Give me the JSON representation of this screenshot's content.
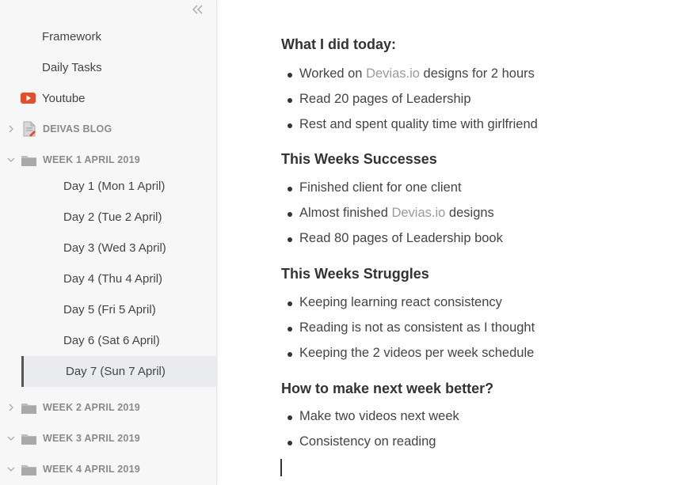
{
  "sidebar": {
    "items": [
      {
        "label": "Framework"
      },
      {
        "label": "Daily Tasks"
      },
      {
        "label": "Youtube"
      }
    ],
    "folders": [
      {
        "label": "DEIVAS BLOG"
      },
      {
        "label": "WEEK 1 APRIL 2019"
      },
      {
        "label": "WEEK 2 APRIL 2019"
      },
      {
        "label": "WEEK 3 APRIL 2019"
      },
      {
        "label": "WEEK 4 APRIL 2019"
      }
    ],
    "week1_days": [
      {
        "label": "Day 1 (Mon 1 April)"
      },
      {
        "label": "Day 2 (Tue 2 April)"
      },
      {
        "label": "Day 3 (Wed 3 April)"
      },
      {
        "label": "Day 4 (Thu 4 April)"
      },
      {
        "label": "Day 5 (Fri 5 April)"
      },
      {
        "label": "Day 6 (Sat 6 April)"
      },
      {
        "label": "Day 7 (Sun 7 April)"
      }
    ]
  },
  "doc": {
    "sections": [
      {
        "heading": "What I did today:",
        "items": [
          {
            "pre": "Worked on ",
            "link": "Devias.io",
            "post": " designs for 2 hours"
          },
          {
            "text": "Read 20 pages of Leadership"
          },
          {
            "text": "Rest and spent quality time with girlfriend"
          }
        ]
      },
      {
        "heading": "This Weeks Successes",
        "items": [
          {
            "text": "Finished client for one client"
          },
          {
            "pre": "Almost finished ",
            "link": "Devias.io",
            "post": " designs"
          },
          {
            "text": "Read 80 pages of Leadership book"
          }
        ]
      },
      {
        "heading": "This Weeks Struggles",
        "items": [
          {
            "text": "Keeping learning react consistency"
          },
          {
            "text": "Reading is not as consistent as I thought"
          },
          {
            "text": "Keeping the 2 videos per week schedule"
          }
        ]
      },
      {
        "heading": "How to make next week better?",
        "items": [
          {
            "text": "Make two videos next week"
          },
          {
            "text": "Consistency on reading"
          }
        ]
      }
    ]
  },
  "colors": {
    "youtube": "#e0502e",
    "selected_bg": "#e9ebee",
    "link": "#9a9a9a"
  }
}
